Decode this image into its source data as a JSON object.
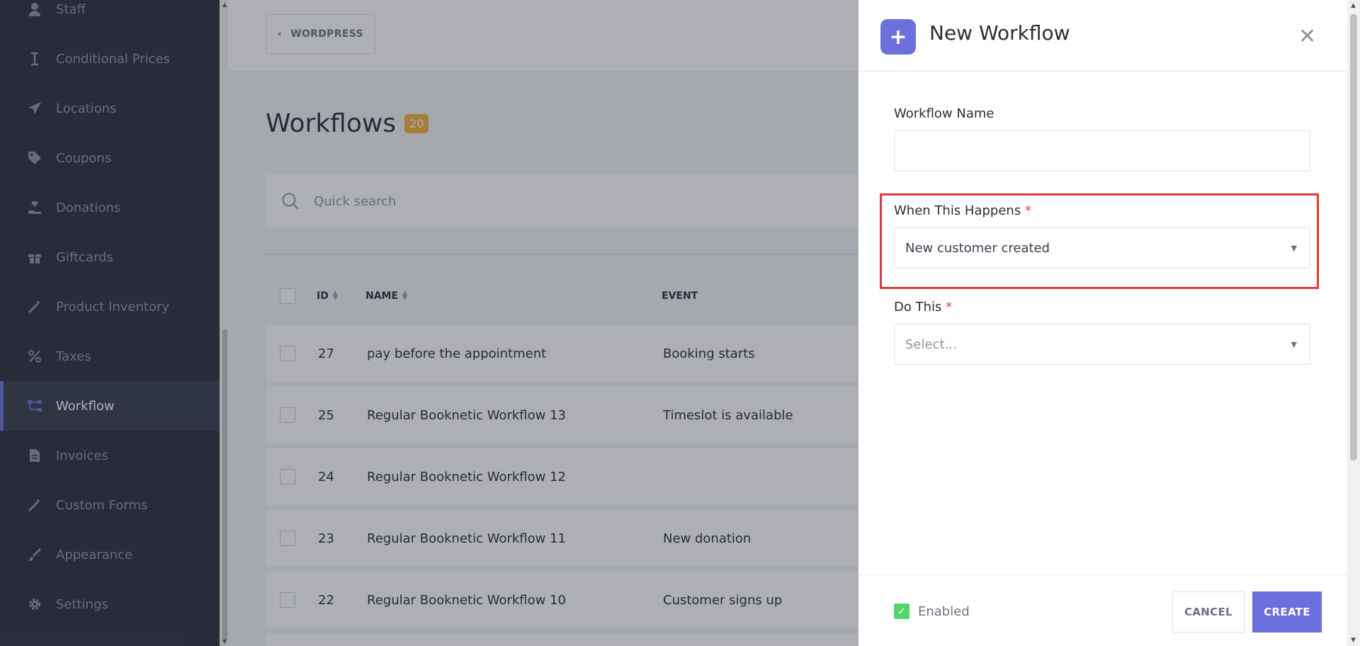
{
  "sidebar": {
    "items": [
      {
        "label": "Staff",
        "icon": "user-icon"
      },
      {
        "label": "Conditional Prices",
        "icon": "cursor-icon"
      },
      {
        "label": "Locations",
        "icon": "send-icon"
      },
      {
        "label": "Coupons",
        "icon": "tag-icon"
      },
      {
        "label": "Donations",
        "icon": "hand-heart-icon"
      },
      {
        "label": "Giftcards",
        "icon": "gift-icon"
      },
      {
        "label": "Product Inventory",
        "icon": "wand-icon"
      },
      {
        "label": "Taxes",
        "icon": "percent-icon"
      },
      {
        "label": "Workflow",
        "icon": "workflow-icon",
        "active": true
      },
      {
        "label": "Invoices",
        "icon": "document-icon"
      },
      {
        "label": "Custom Forms",
        "icon": "wand-icon"
      },
      {
        "label": "Appearance",
        "icon": "brush-icon"
      },
      {
        "label": "Settings",
        "icon": "gear-icon"
      }
    ]
  },
  "topbar": {
    "back_label": "WORDPRESS"
  },
  "page": {
    "title": "Workflows",
    "count": "20"
  },
  "search": {
    "placeholder": "Quick search"
  },
  "table": {
    "columns": {
      "id": "ID",
      "name": "NAME",
      "event": "EVENT"
    },
    "rows": [
      {
        "id": "27",
        "name": "pay before the appointment",
        "event": "Booking starts"
      },
      {
        "id": "25",
        "name": "Regular Booknetic Workflow 13",
        "event": "Timeslot is available"
      },
      {
        "id": "24",
        "name": "Regular Booknetic Workflow 12",
        "event": ""
      },
      {
        "id": "23",
        "name": "Regular Booknetic Workflow 11",
        "event": "New donation"
      },
      {
        "id": "22",
        "name": "Regular Booknetic Workflow 10",
        "event": "Customer signs up"
      }
    ]
  },
  "panel": {
    "title": "New Workflow",
    "name_label": "Workflow Name",
    "name_value": "",
    "when_label": "When This Happens",
    "when_value": "New customer created",
    "do_label": "Do This",
    "do_placeholder": "Select...",
    "enabled_label": "Enabled",
    "enabled_checked": true,
    "cancel_label": "CANCEL",
    "create_label": "CREATE"
  },
  "colors": {
    "accent": "#6c70dc",
    "sidebar_bg": "#292d3a",
    "badge": "#f4b13f",
    "highlight": "#e03a3a",
    "check": "#53d56c"
  }
}
